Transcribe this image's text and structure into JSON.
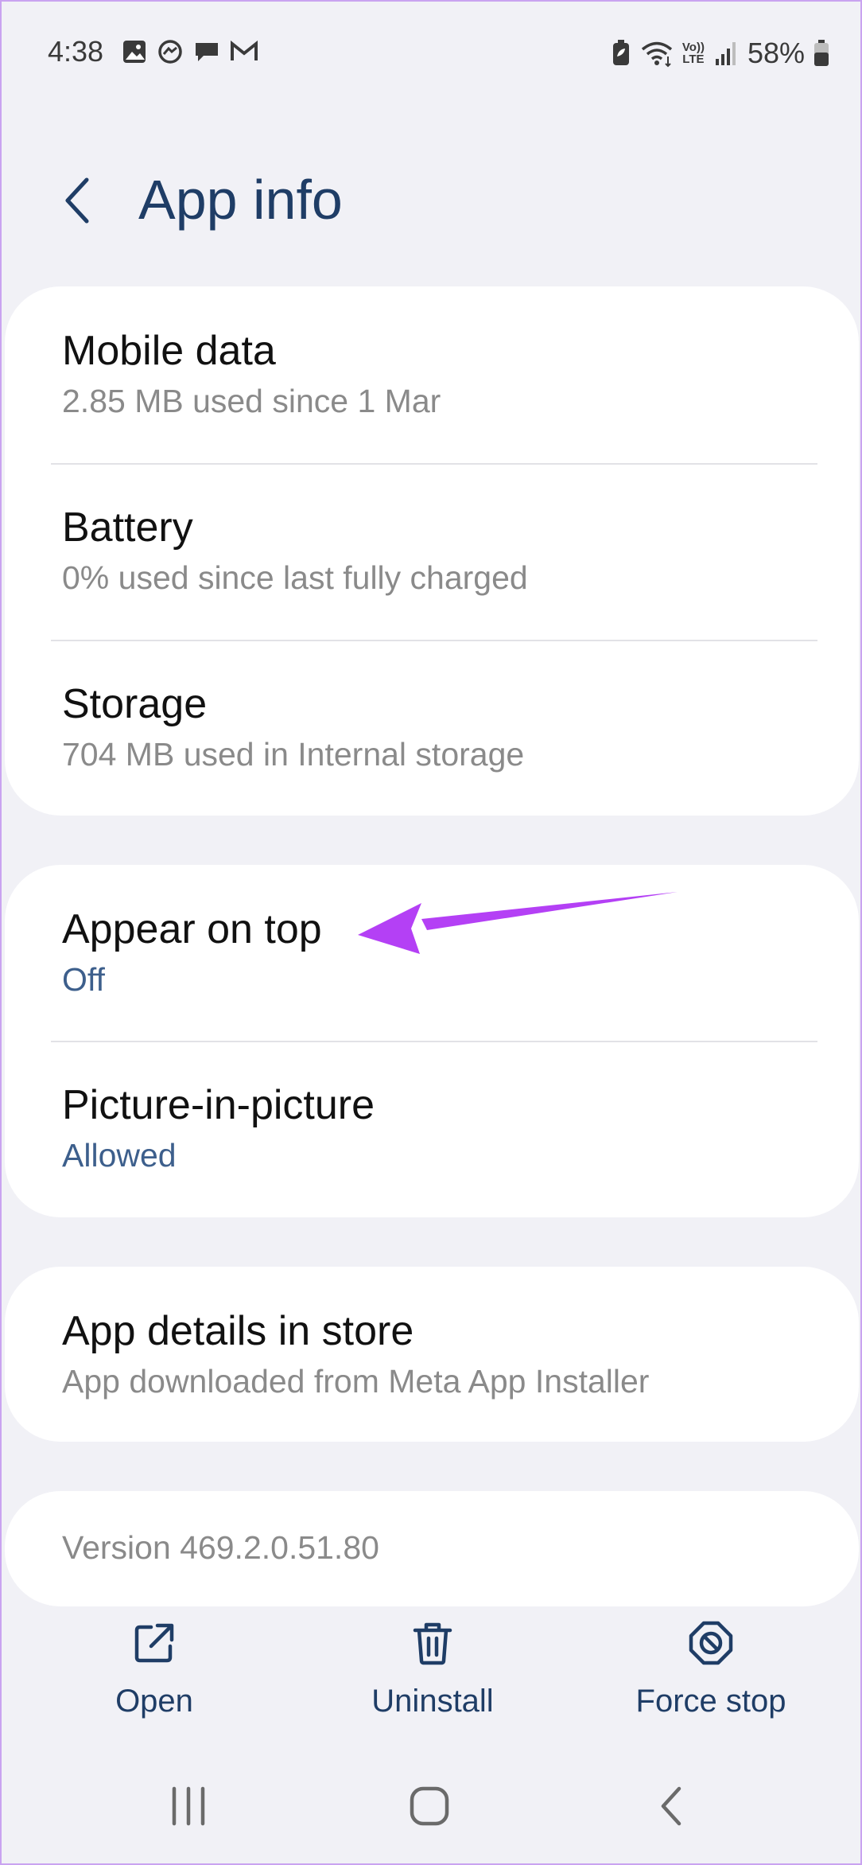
{
  "status_bar": {
    "time": "4:38",
    "left_icons": [
      "gallery-icon",
      "messenger-icon",
      "chat-icon",
      "gmail-icon"
    ],
    "right_icons": [
      "battery-saver-icon",
      "wifi-icon",
      "volte-icon",
      "signal-icon"
    ],
    "volte_label_top": "Vo))",
    "volte_label_bottom": "LTE",
    "battery_percent": "58%"
  },
  "header": {
    "back_icon": "chevron-left-icon",
    "title": "App info"
  },
  "sections": {
    "usage": [
      {
        "title": "Mobile data",
        "subtitle": "2.85 MB used since 1 Mar"
      },
      {
        "title": "Battery",
        "subtitle": "0% used since last fully charged"
      },
      {
        "title": "Storage",
        "subtitle": "704 MB used in Internal storage"
      }
    ],
    "permissions": [
      {
        "title": "Appear on top",
        "subtitle": "Off"
      },
      {
        "title": "Picture-in-picture",
        "subtitle": "Allowed"
      }
    ],
    "store": [
      {
        "title": "App details in store",
        "subtitle": "App downloaded from Meta App Installer"
      }
    ],
    "version": "Version 469.2.0.51.80"
  },
  "actions": {
    "open": {
      "label": "Open",
      "icon": "open-external-icon"
    },
    "uninstall": {
      "label": "Uninstall",
      "icon": "trash-icon"
    },
    "force_stop": {
      "label": "Force stop",
      "icon": "stop-icon"
    }
  },
  "nav": {
    "recents_icon": "recents-icon",
    "home_icon": "home-icon",
    "back_icon": "back-chevron-icon"
  },
  "colors": {
    "background": "#f1f1f6",
    "card": "#ffffff",
    "title_text": "#1f3d66",
    "accent_blue_text": "#3d5f8c",
    "annotation_arrow": "#b440f5"
  }
}
